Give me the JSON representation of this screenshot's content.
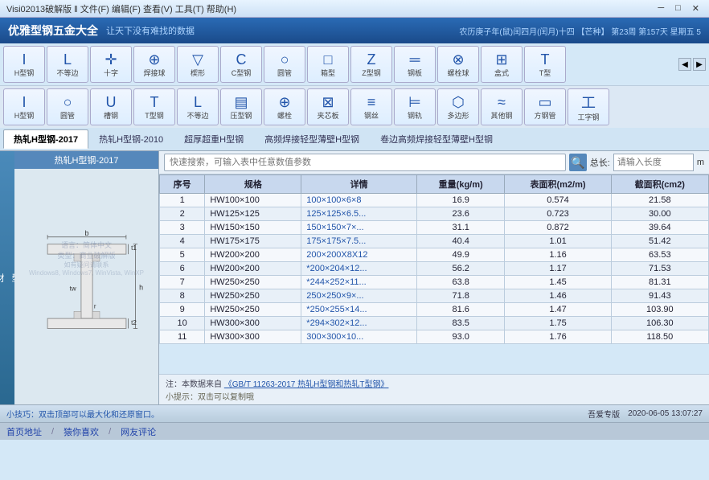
{
  "titlebar": {
    "left": "Visi02013破解版  ‖  文件(F)  编辑(F)  查看(V)  工具(T)  帮助(H)",
    "close_btn": "✕",
    "min_btn": "─",
    "max_btn": "□"
  },
  "app": {
    "title": "优雅型钢五金大全",
    "subtitle": "让天下没有难找的数据",
    "calendar": "农历庚子年(鼠)闰四月(闰月)十四 【芒种】 第23周 第157天 星期五  5",
    "datetime": "2020-06-05  13:07:27",
    "edition": "吾爱专版"
  },
  "toolbar": {
    "row1": [
      {
        "id": "h-beam",
        "icon": "I",
        "label": "H型钢"
      },
      {
        "id": "unequal-angle",
        "icon": "L",
        "label": "不等边"
      },
      {
        "id": "cross",
        "icon": "✛",
        "label": "十字"
      },
      {
        "id": "weld-ball",
        "icon": "⊕",
        "label": "焊接球"
      },
      {
        "id": "wedge",
        "icon": "▽",
        "label": "楔形"
      },
      {
        "id": "c-beam",
        "icon": "C",
        "label": "C型钢"
      },
      {
        "id": "round-pipe",
        "icon": "○",
        "label": "圆管"
      },
      {
        "id": "box",
        "icon": "□",
        "label": "箱型"
      },
      {
        "id": "z-beam",
        "icon": "Z",
        "label": "Z型钢"
      },
      {
        "id": "plate",
        "icon": "═",
        "label": "钢板"
      },
      {
        "id": "bolt",
        "icon": "⊗",
        "label": "螺栓球"
      },
      {
        "id": "box2",
        "icon": "⊞",
        "label": "盒式"
      },
      {
        "id": "t-beam",
        "icon": "T",
        "label": "T型"
      }
    ],
    "row2": [
      {
        "id": "h-beam2",
        "icon": "I",
        "label": "H型钢"
      },
      {
        "id": "round-pipe2",
        "icon": "○",
        "label": "圆管"
      },
      {
        "id": "groove",
        "icon": "U",
        "label": "槽钢"
      },
      {
        "id": "t-beam2",
        "icon": "T",
        "label": "T型钢"
      },
      {
        "id": "unequal2",
        "icon": "L",
        "label": "不等边"
      },
      {
        "id": "press",
        "icon": "▤",
        "label": "压型钢"
      },
      {
        "id": "bolt2",
        "icon": "⊕",
        "label": "螺栓"
      },
      {
        "id": "core",
        "icon": "⊠",
        "label": "夹芯板"
      },
      {
        "id": "wire",
        "icon": "≡",
        "label": "钢丝"
      },
      {
        "id": "rail",
        "icon": "⊨",
        "label": "钢轨"
      },
      {
        "id": "polygon",
        "icon": "⬡",
        "label": "多边形"
      },
      {
        "id": "other",
        "icon": "≈",
        "label": "其他钢"
      },
      {
        "id": "square-pipe",
        "icon": "▭",
        "label": "方钢管"
      },
      {
        "id": "i-beam",
        "icon": "工",
        "label": "工字钢"
      }
    ]
  },
  "category_tabs": [
    {
      "id": "hot-rolled-2017",
      "label": "热轧H型钢-2017",
      "active": true
    },
    {
      "id": "hot-rolled-2010",
      "label": "热轧H型钢-2010"
    },
    {
      "id": "super-heavy",
      "label": "超厚超重H型钢"
    },
    {
      "id": "high-freq-thin",
      "label": "高频焊接轻型薄壁H型钢"
    },
    {
      "id": "edge-high-freq",
      "label": "卷边高频焊接轻型薄壁H型钢"
    }
  ],
  "sidebar": {
    "text": "型材"
  },
  "diagram": {
    "title": "热轧H型钢-2017",
    "labels": {
      "b": "b",
      "t1": "t1",
      "t2": "t2",
      "h": "h",
      "tw": "tw",
      "r": "r"
    },
    "watermark_lines": [
      "语言：简体中文",
      "类型：商业破解版",
      "如有疑问请联系",
      "Windows8, Windows7, WinVista, WinXP"
    ]
  },
  "search": {
    "placeholder": "快速搜索，可输入表中任意数值参数",
    "length_label": "总长:",
    "length_placeholder": "请输入长度",
    "unit": "m"
  },
  "table": {
    "headers": [
      "序号",
      "规格",
      "详情",
      "重量(kg/m)",
      "表面积(m2/m)",
      "截面积(cm2)"
    ],
    "rows": [
      {
        "no": 1,
        "spec": "HW100×100",
        "detail": "100×100×6×8",
        "weight": "16.9",
        "surface": "0.574",
        "area": "21.58"
      },
      {
        "no": 2,
        "spec": "HW125×125",
        "detail": "125×125×6.5...",
        "weight": "23.6",
        "surface": "0.723",
        "area": "30.00"
      },
      {
        "no": 3,
        "spec": "HW150×150",
        "detail": "150×150×7×...",
        "weight": "31.1",
        "surface": "0.872",
        "area": "39.64"
      },
      {
        "no": 4,
        "spec": "HW175×175",
        "detail": "175×175×7.5...",
        "weight": "40.4",
        "surface": "1.01",
        "area": "51.42"
      },
      {
        "no": 5,
        "spec": "HW200×200",
        "detail": "200×200X8X12",
        "weight": "49.9",
        "surface": "1.16",
        "area": "63.53"
      },
      {
        "no": 6,
        "spec": "HW200×200",
        "detail": "*200×204×12...",
        "weight": "56.2",
        "surface": "1.17",
        "area": "71.53"
      },
      {
        "no": 7,
        "spec": "HW250×250",
        "detail": "*244×252×11...",
        "weight": "63.8",
        "surface": "1.45",
        "area": "81.31"
      },
      {
        "no": 8,
        "spec": "HW250×250",
        "detail": "250×250×9×...",
        "weight": "71.8",
        "surface": "1.46",
        "area": "91.43"
      },
      {
        "no": 9,
        "spec": "HW250×250",
        "detail": "*250×255×14...",
        "weight": "81.6",
        "surface": "1.47",
        "area": "103.90"
      },
      {
        "no": 10,
        "spec": "HW300×300",
        "detail": "*294×302×12...",
        "weight": "83.5",
        "surface": "1.75",
        "area": "106.30"
      },
      {
        "no": 11,
        "spec": "HW300×300",
        "detail": "300×300×10...",
        "weight": "93.0",
        "surface": "1.76",
        "area": "118.50"
      }
    ]
  },
  "notes": {
    "note": "注：本数据来自《GB/T 11263-2017 热轧H型钢和热轧T型钢》",
    "hint": "小提示：双击可以复制哦"
  },
  "status": {
    "tip": "小技巧：双击顶部可以最大化和还原窗口。",
    "edition": "吾爱专版",
    "datetime": "2020-06-05  13:07:27"
  },
  "bottom_nav": [
    {
      "id": "home",
      "label": "首页地址"
    },
    {
      "id": "love",
      "label": "猿你喜欢"
    },
    {
      "id": "online",
      "label": "网友评论"
    }
  ]
}
